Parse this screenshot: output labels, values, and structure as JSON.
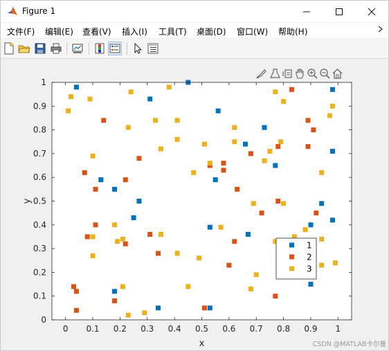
{
  "window": {
    "title": "Figure 1",
    "controls": {
      "minimize": "—",
      "maximize": "☐",
      "close": "✕"
    }
  },
  "menu": [
    {
      "label": "文件(F)"
    },
    {
      "label": "编辑(E)"
    },
    {
      "label": "查看(V)"
    },
    {
      "label": "插入(I)"
    },
    {
      "label": "工具(T)"
    },
    {
      "label": "桌面(D)"
    },
    {
      "label": "窗口(W)"
    },
    {
      "label": "帮助(H)"
    }
  ],
  "menu_overflow_icon": "chevron-right-icon",
  "toolbar_icons": [
    "new-figure-icon",
    "open-file-icon",
    "save-icon",
    "print-icon",
    "link-plot-icon",
    "colorbar-icon",
    "legend-icon",
    "pointer-icon",
    "property-inspector-icon"
  ],
  "plot_tools": [
    "brush-icon",
    "data-tips-icon",
    "rotate-icon",
    "pan-icon",
    "zoom-in-icon",
    "zoom-out-icon",
    "home-icon"
  ],
  "watermark": "CSDN @MATLAB卡尔曼",
  "chart_data": {
    "type": "scatter",
    "xlabel": "x",
    "ylabel": "y",
    "xlim": [
      -0.05,
      1.05
    ],
    "ylim": [
      0,
      1
    ],
    "xticks": [
      "0",
      "0.1",
      "0.2",
      "0.3",
      "0.4",
      "0.5",
      "0.6",
      "0.7",
      "0.8",
      "0.9",
      "1"
    ],
    "yticks": [
      "0",
      "0.1",
      "0.2",
      "0.3",
      "0.4",
      "0.5",
      "0.6",
      "0.7",
      "0.8",
      "0.9",
      "1"
    ],
    "grid": false,
    "legend_position": "bottom-right",
    "colors": [
      "#0072bd",
      "#d95319",
      "#edb120"
    ],
    "series": [
      {
        "name": "1",
        "color": "#0072bd",
        "points": [
          [
            0.04,
            0.98
          ],
          [
            0.13,
            0.59
          ],
          [
            0.18,
            0.55
          ],
          [
            0.18,
            0.12
          ],
          [
            0.25,
            0.43
          ],
          [
            0.27,
            0.5
          ],
          [
            0.31,
            0.93
          ],
          [
            0.34,
            0.05
          ],
          [
            0.45,
            1.0
          ],
          [
            0.53,
            0.39
          ],
          [
            0.53,
            0.05
          ],
          [
            0.55,
            0.59
          ],
          [
            0.56,
            0.88
          ],
          [
            0.66,
            0.74
          ],
          [
            0.67,
            0.36
          ],
          [
            0.73,
            0.81
          ],
          [
            0.77,
            0.65
          ],
          [
            0.9,
            0.4
          ],
          [
            0.9,
            0.15
          ],
          [
            0.94,
            0.49
          ],
          [
            0.98,
            0.97
          ],
          [
            0.98,
            0.71
          ],
          [
            0.98,
            0.42
          ]
        ]
      },
      {
        "name": "2",
        "color": "#d95319",
        "points": [
          [
            0.03,
            0.14
          ],
          [
            0.04,
            0.12
          ],
          [
            0.04,
            0.04
          ],
          [
            0.07,
            0.62
          ],
          [
            0.08,
            0.35
          ],
          [
            0.11,
            0.55
          ],
          [
            0.11,
            0.4
          ],
          [
            0.14,
            0.84
          ],
          [
            0.18,
            0.08
          ],
          [
            0.22,
            0.59
          ],
          [
            0.22,
            0.32
          ],
          [
            0.27,
            0.68
          ],
          [
            0.31,
            0.36
          ],
          [
            0.34,
            0.28
          ],
          [
            0.51,
            0.05
          ],
          [
            0.53,
            0.65
          ],
          [
            0.58,
            0.66
          ],
          [
            0.58,
            0.63
          ],
          [
            0.6,
            0.23
          ],
          [
            0.62,
            0.33
          ],
          [
            0.63,
            0.55
          ],
          [
            0.68,
            0.7
          ],
          [
            0.72,
            0.45
          ],
          [
            0.77,
            0.1
          ],
          [
            0.78,
            0.73
          ],
          [
            0.78,
            0.5
          ],
          [
            0.83,
            0.97
          ],
          [
            0.89,
            0.84
          ],
          [
            0.89,
            0.73
          ],
          [
            0.91,
            0.8
          ],
          [
            0.92,
            0.45
          ]
        ]
      },
      {
        "name": "3",
        "color": "#edb120",
        "points": [
          [
            0.01,
            0.88
          ],
          [
            0.02,
            0.94
          ],
          [
            0.09,
            0.93
          ],
          [
            0.1,
            0.35
          ],
          [
            0.1,
            0.27
          ],
          [
            0.1,
            0.69
          ],
          [
            0.18,
            0.4
          ],
          [
            0.19,
            0.33
          ],
          [
            0.21,
            0.34
          ],
          [
            0.21,
            0.14
          ],
          [
            0.23,
            0.81
          ],
          [
            0.23,
            0.02
          ],
          [
            0.24,
            0.96
          ],
          [
            0.29,
            0.03
          ],
          [
            0.33,
            0.84
          ],
          [
            0.35,
            0.72
          ],
          [
            0.35,
            0.36
          ],
          [
            0.38,
            0.98
          ],
          [
            0.41,
            0.76
          ],
          [
            0.41,
            0.84
          ],
          [
            0.41,
            0.28
          ],
          [
            0.45,
            0.14
          ],
          [
            0.47,
            0.62
          ],
          [
            0.49,
            0.26
          ],
          [
            0.51,
            0.74
          ],
          [
            0.53,
            0.66
          ],
          [
            0.57,
            0.39
          ],
          [
            0.62,
            0.81
          ],
          [
            0.62,
            0.75
          ],
          [
            0.68,
            0.13
          ],
          [
            0.69,
            0.49
          ],
          [
            0.7,
            0.19
          ],
          [
            0.73,
            0.67
          ],
          [
            0.75,
            0.71
          ],
          [
            0.77,
            0.96
          ],
          [
            0.77,
            0.33
          ],
          [
            0.79,
            0.75
          ],
          [
            0.8,
            0.92
          ],
          [
            0.8,
            0.49
          ],
          [
            0.84,
            0.35
          ],
          [
            0.88,
            0.38
          ],
          [
            0.94,
            0.62
          ],
          [
            0.94,
            0.34
          ],
          [
            0.94,
            0.23
          ],
          [
            0.97,
            0.86
          ],
          [
            0.98,
            0.9
          ],
          [
            0.99,
            0.24
          ]
        ]
      }
    ]
  }
}
